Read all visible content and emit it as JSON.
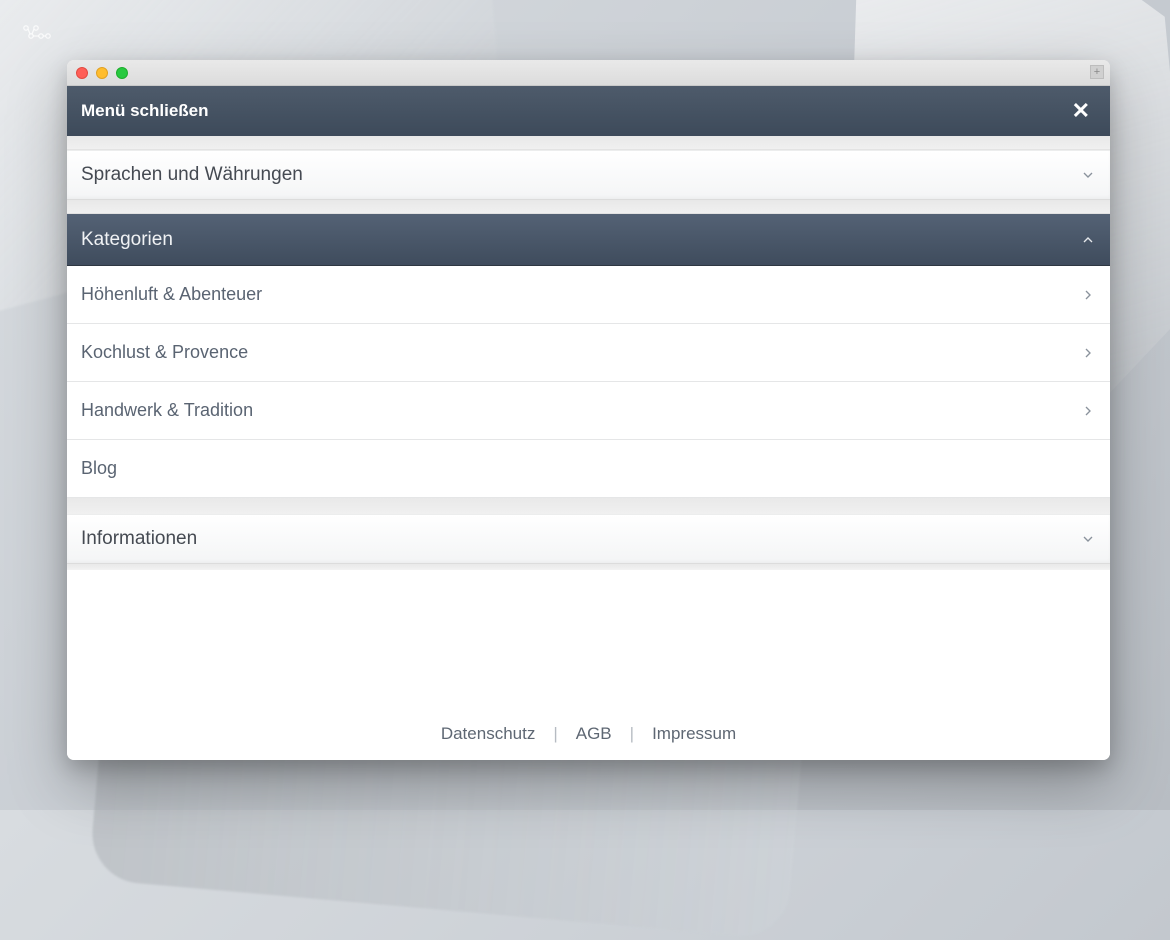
{
  "header": {
    "close_label": "Menü schließen"
  },
  "sections": {
    "languages": {
      "label": "Sprachen und Währungen"
    },
    "categories": {
      "label": "Kategorien",
      "items": [
        {
          "label": "Höhenluft & Abenteuer",
          "has_children": true
        },
        {
          "label": "Kochlust & Provence",
          "has_children": true
        },
        {
          "label": "Handwerk & Tradition",
          "has_children": true
        },
        {
          "label": "Blog",
          "has_children": false
        }
      ]
    },
    "information": {
      "label": "Informationen"
    }
  },
  "footer": {
    "links": [
      {
        "label": "Datenschutz"
      },
      {
        "label": "AGB"
      },
      {
        "label": "Impressum"
      }
    ]
  }
}
